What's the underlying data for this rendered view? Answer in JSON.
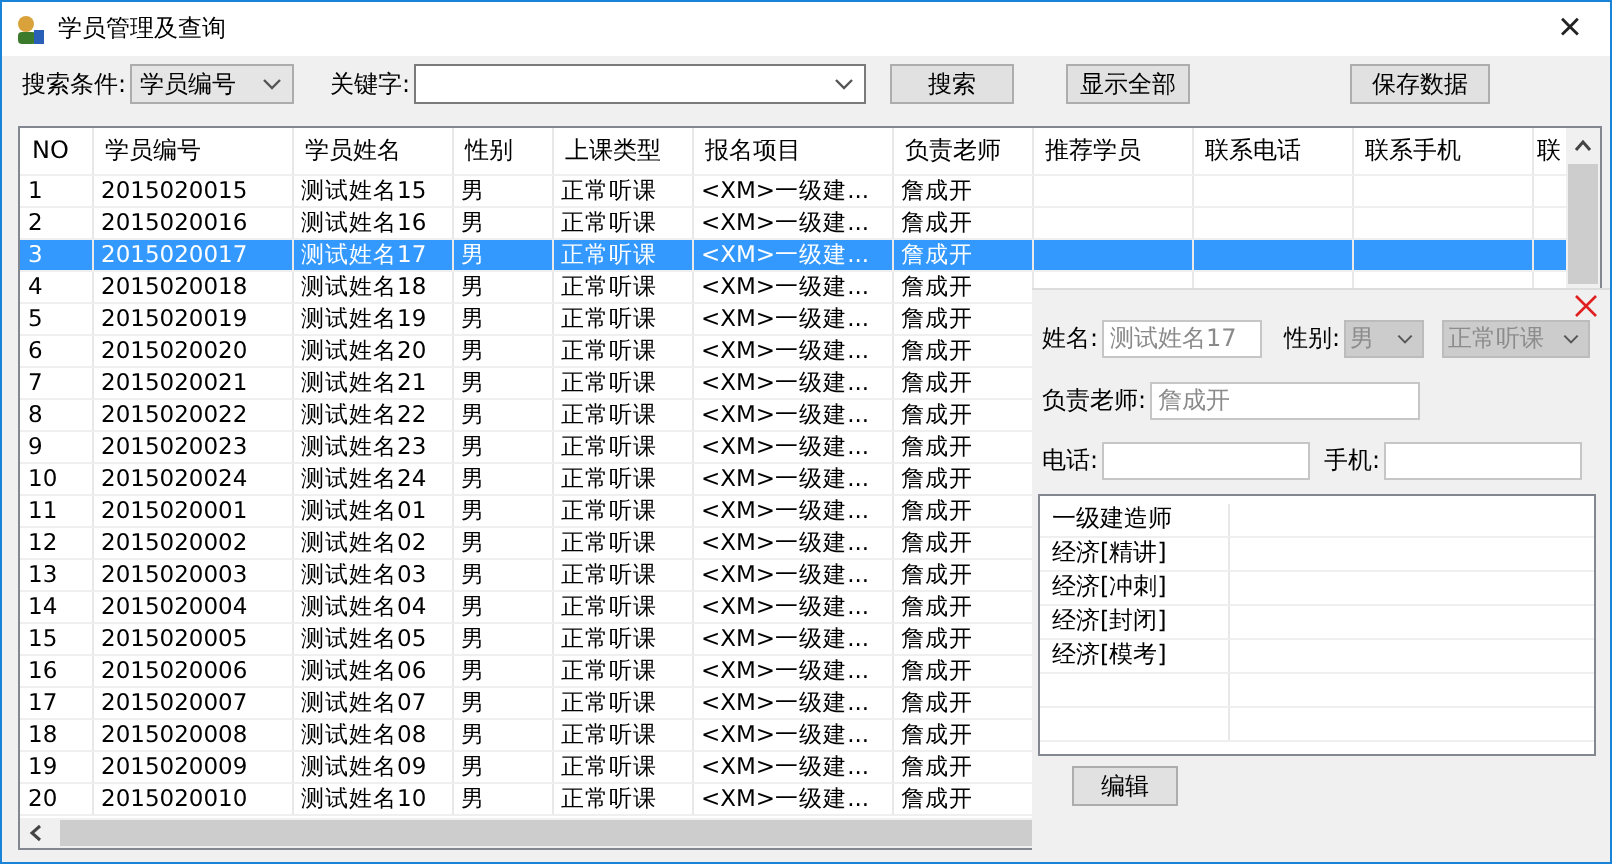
{
  "window": {
    "title": "学员管理及查询",
    "close": "×"
  },
  "toolbar": {
    "condition_label": "搜索条件:",
    "condition_value": "学员编号",
    "keyword_label": "关键字:",
    "buttons": [
      "搜索",
      "显示全部",
      "保存数据"
    ]
  },
  "table": {
    "columns": [
      "NO",
      "学员编号",
      "学员姓名",
      "性别",
      "上课类型",
      "报名项目",
      "负责老师",
      "推荐学员",
      "联系电话",
      "联系手机",
      "联"
    ],
    "rows": [
      {
        "cells": [
          "1",
          "2015020015",
          "测试姓名15",
          "男",
          "正常听课",
          "<XM>一级建...",
          "詹成开"
        ],
        "selected": false
      },
      {
        "cells": [
          "2",
          "2015020016",
          "测试姓名16",
          "男",
          "正常听课",
          "<XM>一级建...",
          "詹成开"
        ],
        "selected": false
      },
      {
        "cells": [
          "3",
          "2015020017",
          "测试姓名17",
          "男",
          "正常听课",
          "<XM>一级建...",
          "詹成开"
        ],
        "selected": true
      },
      {
        "cells": [
          "4",
          "2015020018",
          "测试姓名18",
          "男",
          "正常听课",
          "<XM>一级建...",
          "詹成开"
        ],
        "selected": false
      },
      {
        "cells": [
          "5",
          "2015020019",
          "测试姓名19",
          "男",
          "正常听课",
          "<XM>一级建...",
          "詹成开"
        ],
        "selected": false
      },
      {
        "cells": [
          "6",
          "2015020020",
          "测试姓名20",
          "男",
          "正常听课",
          "<XM>一级建...",
          "詹成开"
        ],
        "selected": false
      },
      {
        "cells": [
          "7",
          "2015020021",
          "测试姓名21",
          "男",
          "正常听课",
          "<XM>一级建...",
          "詹成开"
        ],
        "selected": false
      },
      {
        "cells": [
          "8",
          "2015020022",
          "测试姓名22",
          "男",
          "正常听课",
          "<XM>一级建...",
          "詹成开"
        ],
        "selected": false
      },
      {
        "cells": [
          "9",
          "2015020023",
          "测试姓名23",
          "男",
          "正常听课",
          "<XM>一级建...",
          "詹成开"
        ],
        "selected": false
      },
      {
        "cells": [
          "10",
          "2015020024",
          "测试姓名24",
          "男",
          "正常听课",
          "<XM>一级建...",
          "詹成开"
        ],
        "selected": false
      },
      {
        "cells": [
          "11",
          "2015020001",
          "测试姓名01",
          "男",
          "正常听课",
          "<XM>一级建...",
          "詹成开"
        ],
        "selected": false
      },
      {
        "cells": [
          "12",
          "2015020002",
          "测试姓名02",
          "男",
          "正常听课",
          "<XM>一级建...",
          "詹成开"
        ],
        "selected": false
      },
      {
        "cells": [
          "13",
          "2015020003",
          "测试姓名03",
          "男",
          "正常听课",
          "<XM>一级建...",
          "詹成开"
        ],
        "selected": false
      },
      {
        "cells": [
          "14",
          "2015020004",
          "测试姓名04",
          "男",
          "正常听课",
          "<XM>一级建...",
          "詹成开"
        ],
        "selected": false
      },
      {
        "cells": [
          "15",
          "2015020005",
          "测试姓名05",
          "男",
          "正常听课",
          "<XM>一级建...",
          "詹成开"
        ],
        "selected": false
      },
      {
        "cells": [
          "16",
          "2015020006",
          "测试姓名06",
          "男",
          "正常听课",
          "<XM>一级建...",
          "詹成开"
        ],
        "selected": false
      },
      {
        "cells": [
          "17",
          "2015020007",
          "测试姓名07",
          "男",
          "正常听课",
          "<XM>一级建...",
          "詹成开"
        ],
        "selected": false
      },
      {
        "cells": [
          "18",
          "2015020008",
          "测试姓名08",
          "男",
          "正常听课",
          "<XM>一级建...",
          "詹成开"
        ],
        "selected": false
      },
      {
        "cells": [
          "19",
          "2015020009",
          "测试姓名09",
          "男",
          "正常听课",
          "<XM>一级建...",
          "詹成开"
        ],
        "selected": false
      },
      {
        "cells": [
          "20",
          "2015020010",
          "测试姓名10",
          "男",
          "正常听课",
          "<XM>一级建...",
          "詹成开"
        ],
        "selected": false
      }
    ]
  },
  "detail_panel": {
    "name_label": "姓名:",
    "name_value": "测试姓名17",
    "name_disabled": true,
    "gender_label": "性别:",
    "gender_value": "男",
    "gender_disabled": true,
    "class_type_value": "正常听课",
    "class_type_disabled": true,
    "teacher_label": "负责老师:",
    "teacher_value": "詹成开",
    "teacher_disabled": true,
    "phone_label": "电话:",
    "mobile_label": "手机:",
    "items": [
      "一级建造师",
      "经济[精讲]",
      "经济[冲刺]",
      "经济[封闭]",
      "经济[模考]"
    ],
    "edit_button": "编辑"
  }
}
